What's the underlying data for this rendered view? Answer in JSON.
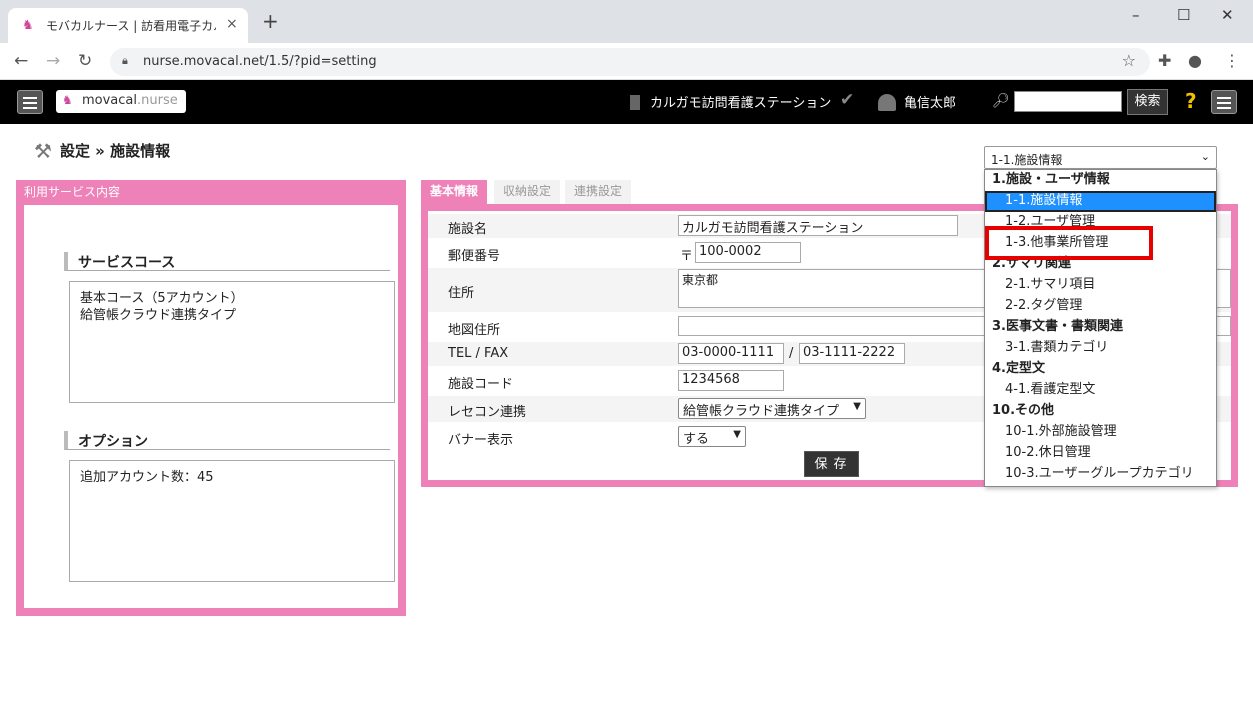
{
  "browser": {
    "tab_title": "モバカルナース | 訪看用電子カルテ",
    "tab_close": "×",
    "new_tab": "+",
    "url": "nurse.movacal.net/1.5/?pid=setting",
    "window_controls": {
      "minimize": "–",
      "maximize": "☐",
      "close": "✕"
    }
  },
  "appbar": {
    "logo_main": "movacal",
    "logo_suffix": ".nurse",
    "station_name": "カルガモ訪問看護ステーション",
    "user_name": "亀信太郎",
    "search_placeholder": "",
    "search_button": "検索",
    "help": "?"
  },
  "page": {
    "title": "設定 » 施設情報"
  },
  "left_panel": {
    "header": "利用サービス内容",
    "service_course_title": "サービスコース",
    "service_course_lines": [
      "基本コース（5アカウント）",
      "給管帳クラウド連携タイプ"
    ],
    "option_title": "オプション",
    "option_lines": [
      "追加アカウント数：45"
    ]
  },
  "tabs": [
    "基本情報",
    "収納設定",
    "連携設定"
  ],
  "form": {
    "facility_name": {
      "label": "施設名",
      "value": "カルガモ訪問看護ステーション"
    },
    "postal": {
      "label": "郵便番号",
      "prefix": "〒",
      "value": "100-0002"
    },
    "address": {
      "label": "住所",
      "value": "東京都"
    },
    "map_address": {
      "label": "地図住所",
      "value": ""
    },
    "tel_fax": {
      "label": "TEL / FAX",
      "tel": "03-0000-1111",
      "sep": "/",
      "fax": "03-1111-2222"
    },
    "facility_code": {
      "label": "施設コード",
      "value": "1234568"
    },
    "receipt": {
      "label": "レセコン連携",
      "value": "給管帳クラウド連携タイプ"
    },
    "banner": {
      "label": "バナー表示",
      "value": "する"
    },
    "save": "保存"
  },
  "dropdown": {
    "selected": "1-1.施設情報",
    "items": [
      {
        "text": "1.施設・ユーザ情報",
        "kind": "group"
      },
      {
        "text": "1-1.施設情報",
        "kind": "option",
        "selected": true
      },
      {
        "text": "1-2.ユーザ管理",
        "kind": "option"
      },
      {
        "text": "1-3.他事業所管理",
        "kind": "option"
      },
      {
        "text": "2.サマリ関連",
        "kind": "group"
      },
      {
        "text": "2-1.サマリ項目",
        "kind": "option"
      },
      {
        "text": "2-2.タグ管理",
        "kind": "option"
      },
      {
        "text": "3.医事文書・書類関連",
        "kind": "group"
      },
      {
        "text": "3-1.書類カテゴリ",
        "kind": "option"
      },
      {
        "text": "4.定型文",
        "kind": "group"
      },
      {
        "text": "4-1.看護定型文",
        "kind": "option"
      },
      {
        "text": "10.その他",
        "kind": "group"
      },
      {
        "text": "10-1.外部施設管理",
        "kind": "option"
      },
      {
        "text": "10-2.休日管理",
        "kind": "option"
      },
      {
        "text": "10-3.ユーザーグループカテゴリ",
        "kind": "option"
      }
    ]
  },
  "colors": {
    "accent_pink": "#ee82b8",
    "header_black": "#000000",
    "highlight_blue": "#1e90ff",
    "annotation_red": "#e60000"
  }
}
